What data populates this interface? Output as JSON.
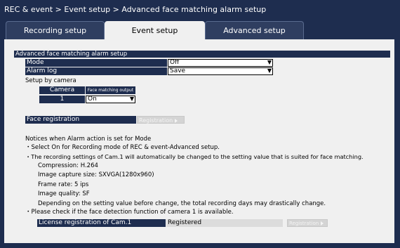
{
  "breadcrumb": "REC & event > Event setup > Advanced face matching alarm setup",
  "tabs": [
    {
      "label": "Recording setup"
    },
    {
      "label": "Event setup"
    },
    {
      "label": "Advanced setup"
    }
  ],
  "section_title": "Advanced face matching alarm setup",
  "mode": {
    "label": "Mode",
    "value": "Off"
  },
  "alarm_log": {
    "label": "Alarm log",
    "value": "Save"
  },
  "setup_by_camera": {
    "label": "Setup by camera",
    "col_camera": "Camera",
    "col_output": "Face matching output",
    "camera": "1",
    "output_value": "On"
  },
  "face_registration": {
    "label": "Face registration",
    "button": "Registration"
  },
  "notices": {
    "line1": "Notices when Alarm action is set for Mode",
    "line2": "・Select On for Recording mode of REC & event-Advanced setup.",
    "line3": "・The recording settings of Cam.1 will automatically be changed to the setting value that is suited for face matching.",
    "compression": "Compression: H.264",
    "capture_size": "Image capture size: SXVGA(1280x960)",
    "frame_rate": "Frame rate: 5 ips",
    "quality": "Image quality: SF",
    "line4": "Depending on the setting value before change, the total recording days may drastically change.",
    "line5": "・Please check if the face detection function of camera 1 is available."
  },
  "license": {
    "label": "License registration of Cam.1",
    "status": "Registered",
    "button": "Registration"
  }
}
